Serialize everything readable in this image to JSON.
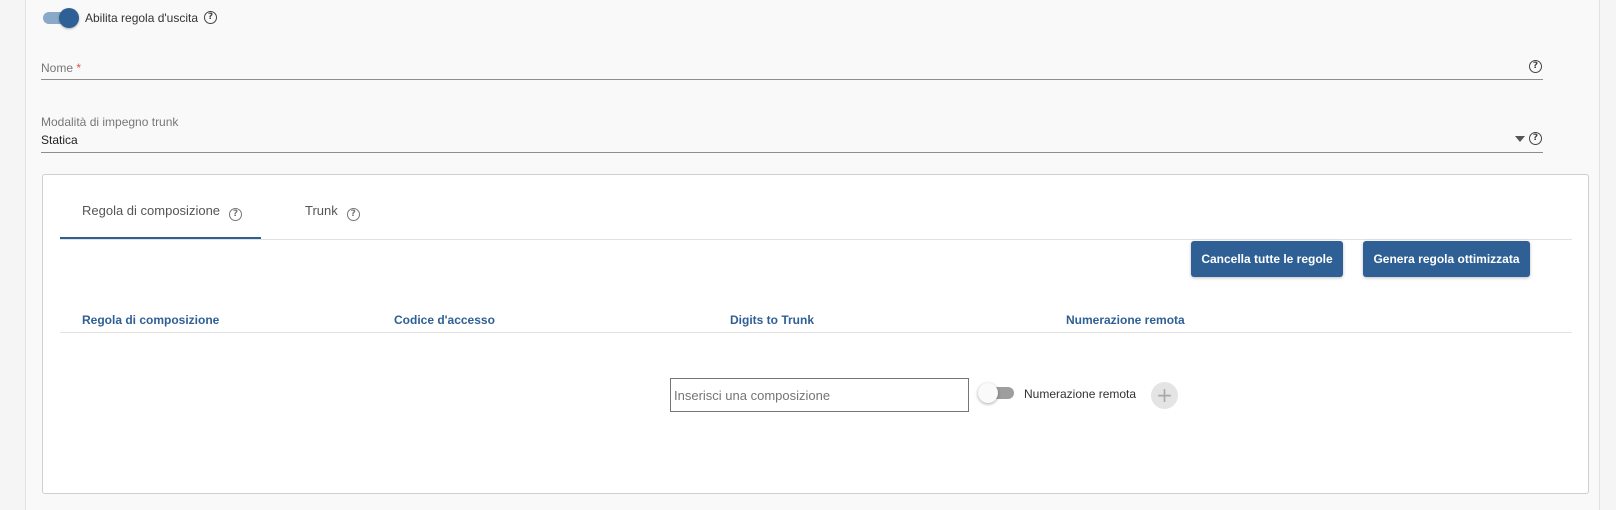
{
  "enable_rule": {
    "label": "Abilita regola d'uscita",
    "enabled": true,
    "help_icon": "question-circle-icon"
  },
  "name_field": {
    "label": "Nome",
    "required_mark": "*",
    "value": ""
  },
  "trunk_mode": {
    "label": "Modalità di impegno trunk",
    "value": "Statica"
  },
  "tabs": [
    {
      "label": "Regola di composizione",
      "active": true
    },
    {
      "label": "Trunk",
      "active": false
    }
  ],
  "actions": {
    "clear_all_label": "Cancella tutte le regole",
    "generate_label": "Genera regola ottimizzata"
  },
  "table": {
    "columns": [
      "Regola di composizione",
      "Codice d'accesso",
      "Digits to Trunk",
      "Numerazione remota"
    ]
  },
  "new_rule": {
    "input_placeholder": "Inserisci una composizione",
    "remote_toggle_label": "Numerazione remota",
    "remote_enabled": false,
    "add_icon": "plus-icon"
  },
  "colors": {
    "accent": "#2e5f95",
    "required": "#d9534f"
  }
}
